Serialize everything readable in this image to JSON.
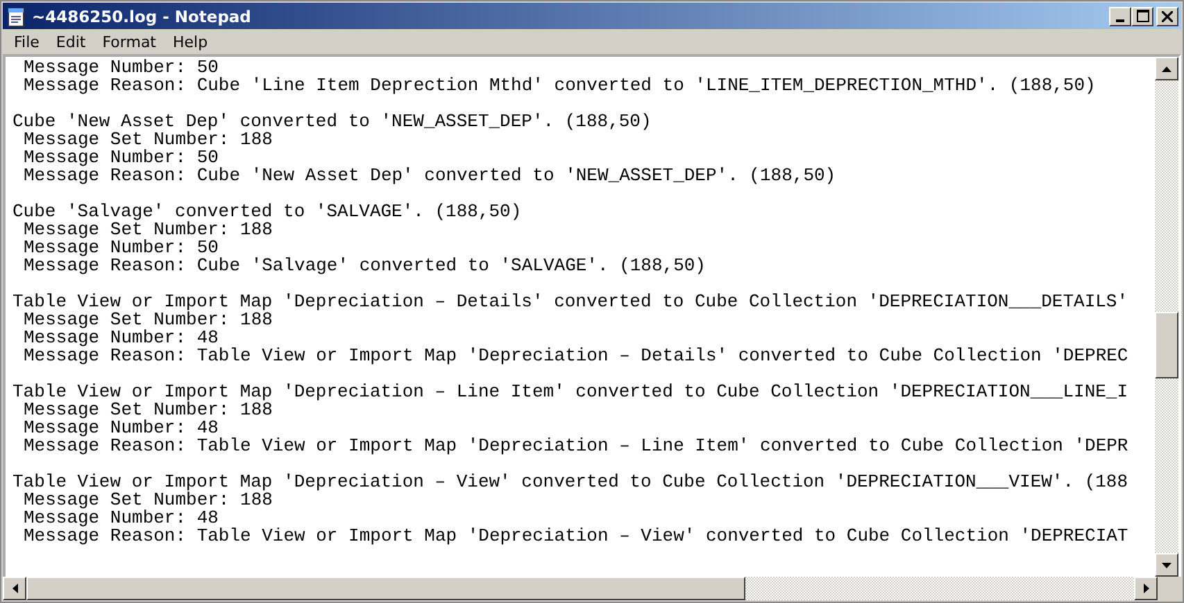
{
  "window": {
    "title": "~4486250.log - Notepad"
  },
  "menu": [
    "File",
    "Edit",
    "Format",
    "Help"
  ],
  "blocks": [
    {
      "details": [
        "Message Number: 50",
        "Message Reason: Cube 'Line Item Deprection Mthd' converted to 'LINE_ITEM_DEPRECTION_MTHD'. (188,50)"
      ]
    },
    {
      "header": "Cube 'New Asset Dep' converted to 'NEW_ASSET_DEP'. (188,50)",
      "details": [
        "Message Set Number: 188",
        "Message Number: 50",
        "Message Reason: Cube 'New Asset Dep' converted to 'NEW_ASSET_DEP'. (188,50)"
      ]
    },
    {
      "header": "Cube 'Salvage' converted to 'SALVAGE'. (188,50)",
      "details": [
        "Message Set Number: 188",
        "Message Number: 50",
        "Message Reason: Cube 'Salvage' converted to 'SALVAGE'. (188,50)"
      ]
    },
    {
      "header": "Table View or Import Map 'Depreciation – Details' converted to Cube Collection 'DEPRECIATION___DETAILS'",
      "details": [
        "Message Set Number: 188",
        "Message Number: 48",
        "Message Reason: Table View or Import Map 'Depreciation – Details' converted to Cube Collection 'DEPREC"
      ]
    },
    {
      "header": "Table View or Import Map 'Depreciation – Line Item' converted to Cube Collection 'DEPRECIATION___LINE_I",
      "details": [
        "Message Set Number: 188",
        "Message Number: 48",
        "Message Reason: Table View or Import Map 'Depreciation – Line Item' converted to Cube Collection 'DEPR"
      ]
    },
    {
      "header": "Table View or Import Map 'Depreciation – View' converted to Cube Collection 'DEPRECIATION___VIEW'. (188",
      "details": [
        "Message Set Number: 188",
        "Message Number: 48",
        "Message Reason: Table View or Import Map 'Depreciation – View' converted to Cube Collection 'DEPRECIAT"
      ]
    }
  ]
}
